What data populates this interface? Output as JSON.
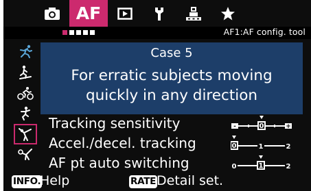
{
  "tabs": [
    {
      "icon": "camera-icon",
      "label": ""
    },
    {
      "icon": "",
      "label": "AF"
    },
    {
      "icon": "playback-icon",
      "label": ""
    },
    {
      "icon": "wrench-icon",
      "label": ""
    },
    {
      "icon": "custom-function-icon",
      "label": ""
    },
    {
      "icon": "star-icon",
      "label": ""
    }
  ],
  "active_tab_label": "AF",
  "page_indicator": {
    "current": 1,
    "total": 5
  },
  "menu_id": "AF1:AF config. tool",
  "cases": [
    {
      "name": "case-1",
      "icon": "runner-icon"
    },
    {
      "name": "case-2",
      "icon": "skier-icon"
    },
    {
      "name": "case-3",
      "icon": "cyclist-icon"
    },
    {
      "name": "case-4",
      "icon": "jumper-icon"
    },
    {
      "name": "case-5",
      "icon": "gymnast-icon",
      "selected": true
    },
    {
      "name": "case-6",
      "icon": "reaching-figure-icon"
    }
  ],
  "description": {
    "title": "Case 5",
    "line1": "For erratic subjects moving",
    "line2": "quickly in any direction"
  },
  "params": [
    {
      "label": "Tracking sensitivity",
      "scale": [
        "-",
        "0",
        "+"
      ],
      "value": 0,
      "min": -2,
      "max": 2
    },
    {
      "label": "Accel./decel. tracking",
      "scale": [
        "0",
        "1",
        "2"
      ],
      "value": 0,
      "min": 0,
      "max": 2
    },
    {
      "label": "AF pt auto switching",
      "scale": [
        "0",
        "1",
        "2"
      ],
      "value": 1,
      "min": 0,
      "max": 2
    }
  ],
  "help": {
    "info_key": "INFO.",
    "info_label": "Help",
    "rate_key": "RATE",
    "rate_label": "Detail set."
  },
  "colors": {
    "accent": "#cc2a6e",
    "panel": "#1d3e69",
    "background": "#0d0d0d"
  }
}
